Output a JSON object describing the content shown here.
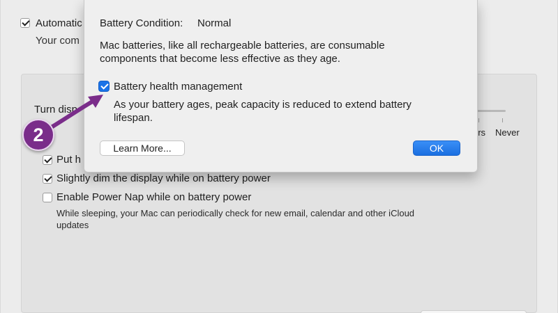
{
  "background": {
    "automatic_label": "Automatic",
    "automatic_sub": "Your com",
    "turn_display_label": "Turn disp",
    "slider_hrs": "hrs",
    "slider_never": "Never",
    "options": [
      {
        "label": "Put h",
        "checked": true
      },
      {
        "label": "Slightly dim the display while on battery power",
        "checked": true
      },
      {
        "label": "Enable Power Nap while on battery power",
        "checked": false
      }
    ],
    "power_nap_desc": "While sleeping, your Mac can periodically check for new email, calendar and other iCloud updates"
  },
  "sheet": {
    "condition_label": "Battery Condition:",
    "condition_value": "Normal",
    "info": "Mac batteries, like all rechargeable batteries, are consumable components that become less effective as they age.",
    "bhm_label": "Battery health management",
    "bhm_checked": true,
    "bhm_desc": "As your battery ages, peak capacity is reduced to extend battery lifespan.",
    "learn_more": "Learn More...",
    "ok": "OK"
  },
  "annotation": {
    "step_number": "2",
    "color": "#7a2d8a"
  },
  "colors": {
    "accent": "#1a73e8"
  }
}
